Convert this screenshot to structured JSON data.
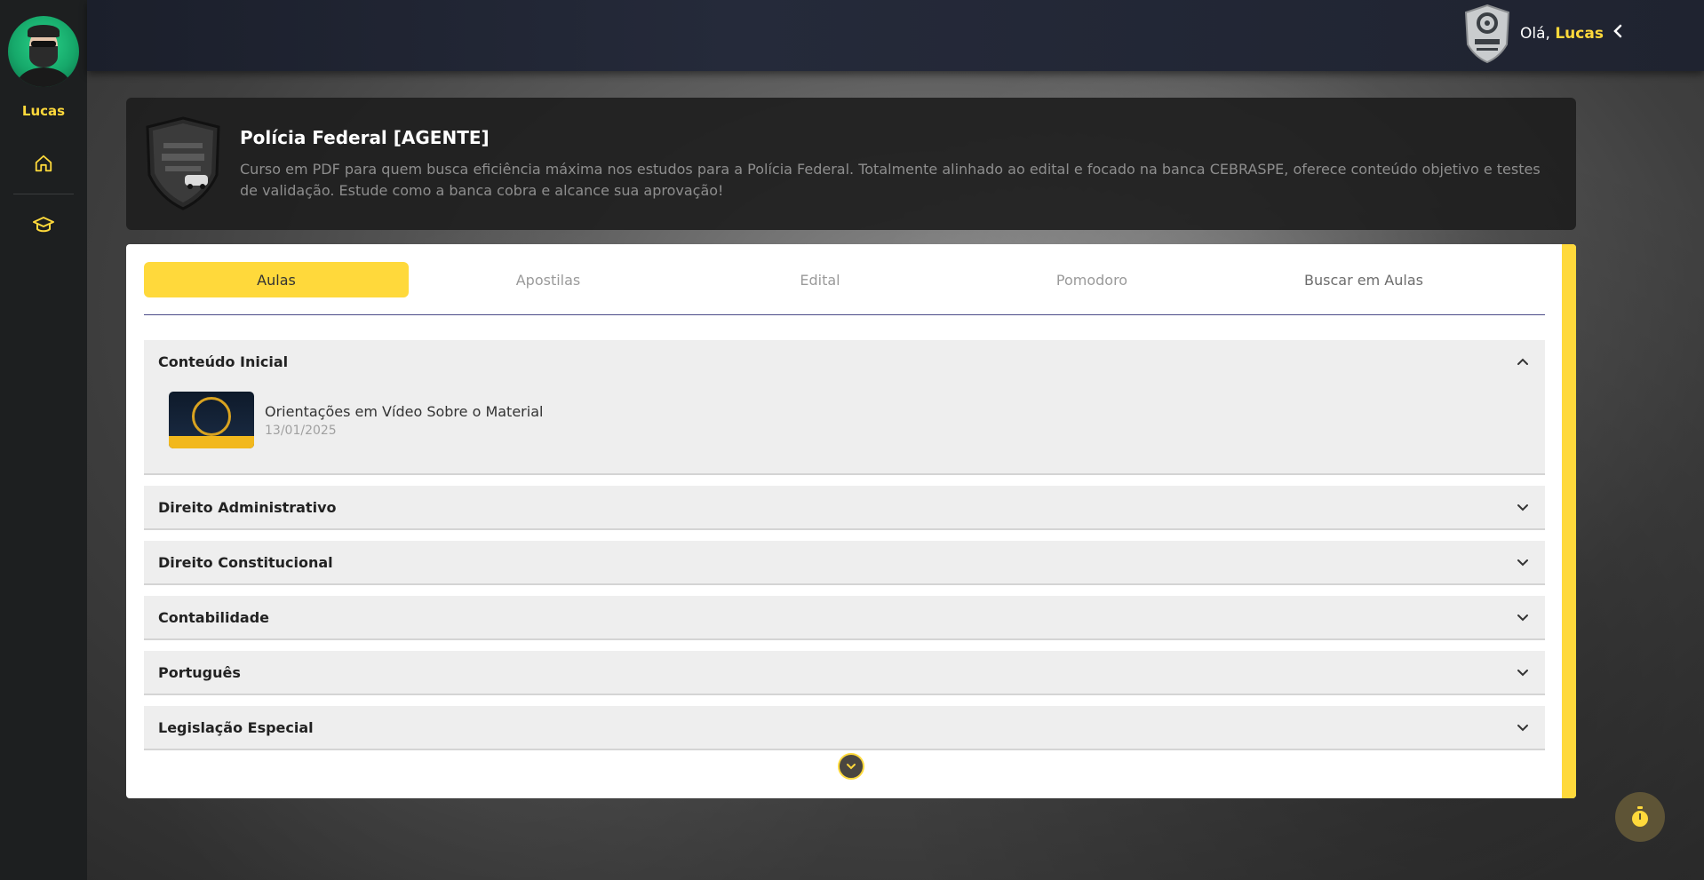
{
  "colors": {
    "accent": "#ffd93b",
    "sidebar": "#1d1f20",
    "panel": "#ffffff",
    "accordion": "#eeeeee"
  },
  "sidebar": {
    "user_name": "Lucas",
    "items": [
      {
        "icon": "home-icon"
      },
      {
        "icon": "graduation-cap-icon"
      }
    ]
  },
  "header": {
    "greeting": "Olá, ",
    "user_name": "Lucas"
  },
  "course": {
    "title": "Polícia Federal [AGENTE]",
    "description": "Curso em PDF para quem busca eficiência máxima nos estudos para a Polícia Federal. Totalmente alinhado ao edital e focado na banca CEBRASPE, oferece conteúdo objetivo e testes de validação. Estude como a banca cobra e alcance sua aprovação!"
  },
  "tabs": [
    {
      "label": "Aulas",
      "active": true
    },
    {
      "label": "Apostilas",
      "active": false
    },
    {
      "label": "Edital",
      "active": false
    },
    {
      "label": "Pomodoro",
      "active": false
    },
    {
      "label": "Buscar em Aulas",
      "active": false
    }
  ],
  "sections": [
    {
      "title": "Conteúdo Inicial",
      "expanded": true,
      "lessons": [
        {
          "title": "Orientações em Vídeo Sobre o Material",
          "date": "13/01/2025"
        }
      ]
    },
    {
      "title": "Direito Administrativo",
      "expanded": false
    },
    {
      "title": "Direito Constitucional",
      "expanded": false
    },
    {
      "title": "Contabilidade",
      "expanded": false
    },
    {
      "title": "Português",
      "expanded": false
    },
    {
      "title": "Legislação Especial",
      "expanded": false
    }
  ]
}
